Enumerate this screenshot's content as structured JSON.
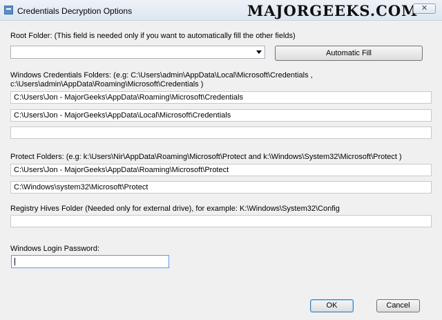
{
  "window": {
    "title": "Credentials Decryption Options",
    "watermark": "MAJORGEEKS.COM",
    "close_glyph": "✕"
  },
  "root_folder": {
    "label": "Root Folder: (This field is needed only if you want to automatically fill the other fields)",
    "value": "",
    "auto_fill_button": "Automatic Fill"
  },
  "credentials_folders": {
    "label_line1": "Windows Credentials Folders:  (e.g: C:\\Users\\admin\\AppData\\Local\\Microsoft\\Credentials ,",
    "label_line2": "c:\\Users\\admin\\AppData\\Roaming\\Microsoft\\Credentials )",
    "fields": [
      "C:\\Users\\Jon - MajorGeeks\\AppData\\Roaming\\Microsoft\\Credentials",
      "C:\\Users\\Jon - MajorGeeks\\AppData\\Local\\Microsoft\\Credentials",
      ""
    ]
  },
  "protect_folders": {
    "label": "Protect Folders: (e.g: k:\\Users\\Nir\\AppData\\Roaming\\Microsoft\\Protect and k:\\Windows\\System32\\Microsoft\\Protect )",
    "fields": [
      "C:\\Users\\Jon - MajorGeeks\\AppData\\Roaming\\Microsoft\\Protect",
      "C:\\Windows\\system32\\Microsoft\\Protect"
    ]
  },
  "registry_hives": {
    "label": "Registry Hives Folder (Needed only for external drive), for example:  K:\\Windows\\System32\\Config",
    "value": ""
  },
  "login_password": {
    "label": "Windows Login Password:",
    "value": ""
  },
  "buttons": {
    "ok": "OK",
    "cancel": "Cancel"
  }
}
